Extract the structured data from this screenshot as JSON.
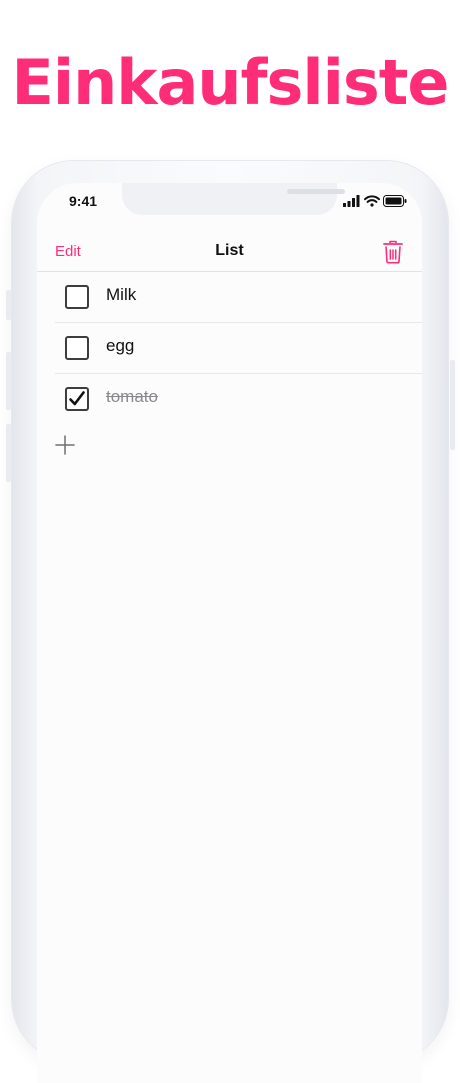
{
  "headline": "Einkaufsliste",
  "colors": {
    "accent": "#ff2d78"
  },
  "status_bar": {
    "time": "9:41",
    "icons": [
      "signal-icon",
      "wifi-icon",
      "battery-icon"
    ]
  },
  "nav": {
    "edit_label": "Edit",
    "title": "List",
    "trash_icon": "trash-icon"
  },
  "items": [
    {
      "label": "Milk",
      "checked": false
    },
    {
      "label": "egg",
      "checked": false
    },
    {
      "label": "tomato",
      "checked": true
    }
  ],
  "add_icon": "plus-icon"
}
